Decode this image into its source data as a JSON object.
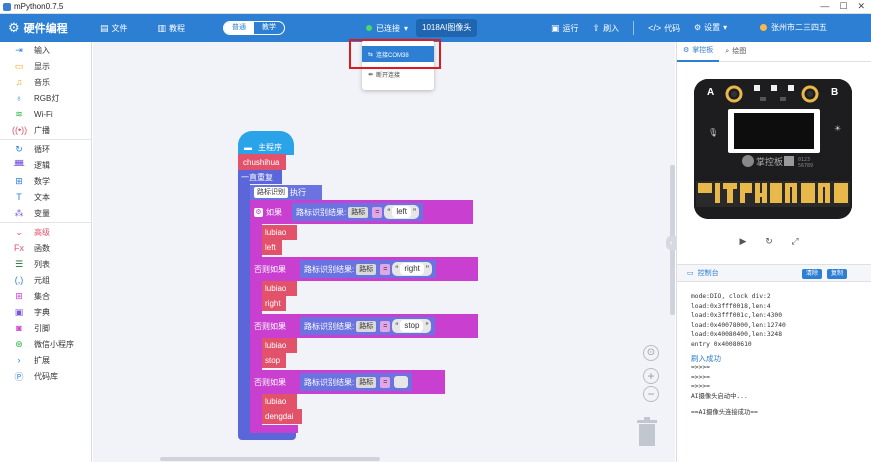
{
  "window": {
    "title": "mPython0.7.5",
    "controls": [
      "—",
      "☐",
      "✕"
    ]
  },
  "toolbar": {
    "brand": "硬件编程",
    "file": "文件",
    "tutorial": "教程",
    "mode_blocks": "普通",
    "mode_code": "教学",
    "connection_status": "已连接",
    "board": "1018AI图像头",
    "run": "运行",
    "flash": "刷入",
    "code": "代码",
    "settings": "设置",
    "user": "张州市二三四五"
  },
  "menu": {
    "items": [
      "连接COM38",
      "断开连接"
    ]
  },
  "sidebar": {
    "items": [
      {
        "label": "输入",
        "icon": "input-icon",
        "color": "#2d7fd3",
        "glyph": "⇥"
      },
      {
        "label": "显示",
        "icon": "display-icon",
        "color": "#f5a623",
        "glyph": "▭"
      },
      {
        "label": "音乐",
        "icon": "music-icon",
        "color": "#f5a623",
        "glyph": "♫"
      },
      {
        "label": "RGB灯",
        "icon": "bulb-icon",
        "color": "#2d7fd3",
        "glyph": "♁"
      },
      {
        "label": "Wi-Fi",
        "icon": "wifi-icon",
        "color": "#2bb24c",
        "glyph": "≋"
      },
      {
        "label": "广播",
        "icon": "broadcast-icon",
        "color": "#e2536b",
        "glyph": "((•))"
      },
      {
        "label": "循环",
        "icon": "loop-icon",
        "color": "#2d7fd3",
        "glyph": "↻"
      },
      {
        "label": "逻辑",
        "icon": "logic-icon",
        "color": "#7b57d8",
        "glyph": "ᚙ"
      },
      {
        "label": "数学",
        "icon": "math-icon",
        "color": "#2d7fd3",
        "glyph": "⊞"
      },
      {
        "label": "文本",
        "icon": "text-icon",
        "color": "#2d7fd3",
        "glyph": "T"
      },
      {
        "label": "变量",
        "icon": "variable-icon",
        "color": "#7b57d8",
        "glyph": "⁂"
      },
      {
        "label": "高级",
        "icon": "chevron-down-icon",
        "color": "#e2536b",
        "glyph": "⌄"
      },
      {
        "label": "函数",
        "icon": "function-icon",
        "color": "#e2536b",
        "glyph": "Fx"
      },
      {
        "label": "列表",
        "icon": "list-icon",
        "color": "#1a6e33",
        "glyph": "☰"
      },
      {
        "label": "元组",
        "icon": "tuple-icon",
        "color": "#2d7fd3",
        "glyph": "(,)"
      },
      {
        "label": "集合",
        "icon": "set-icon",
        "color": "#c940d0",
        "glyph": "⊞"
      },
      {
        "label": "字典",
        "icon": "dict-icon",
        "color": "#7b57d8",
        "glyph": "▣"
      },
      {
        "label": "引脚",
        "icon": "pin-icon",
        "color": "#c940d0",
        "glyph": "◙"
      },
      {
        "label": "微信小程序",
        "icon": "wechat-icon",
        "color": "#2bb24c",
        "glyph": "⊛"
      },
      {
        "label": "扩展",
        "icon": "chevron-right-icon",
        "color": "#2d7fd3",
        "glyph": "›"
      },
      {
        "label": "代码库",
        "icon": "code-lib-icon",
        "color": "#2d7fd3",
        "glyph": "Ⓟ"
      }
    ]
  },
  "blocks": {
    "main": "主程序",
    "init_fn": "chushihua",
    "forever": "一直重复",
    "recognize": "路标识别",
    "execute": "执行",
    "if": "如果",
    "elif": "否则如果",
    "cond_label": "路标识别结果:",
    "cond_sel": "路标",
    "op": "=",
    "branches": [
      {
        "fn": "lubiao",
        "str": "left",
        "action": "left"
      },
      {
        "fn": "lubiao",
        "str": "right",
        "action": "right"
      },
      {
        "fn": "lubiao",
        "str": "stop",
        "action": "stop"
      },
      {
        "fn": "lubiao",
        "str": "",
        "action": "dengdai"
      }
    ],
    "quote_l": "“",
    "quote_r": "”"
  },
  "right_panel": {
    "tab_sim": "掌控板",
    "tab_draw": "绘图",
    "board_text": "掌控板",
    "console_title": "控制台",
    "btn_clear": "清除",
    "btn_copy": "复制",
    "console_lines": [
      "mode:DIO, clock div:2",
      "load:0x3fff0018,len:4",
      "load:0x3fff001c,len:4300",
      "load:0x40078000,len:12740",
      "load:0x40080400,len:3248",
      "entry 0x40080610"
    ],
    "console_ok": "刷入成功",
    "console_tail": [
      "=>>>=",
      "=>>>=",
      "=>>>=",
      "AI摄像头启动中...",
      "",
      "==AI摄像头连接成功=="
    ]
  }
}
